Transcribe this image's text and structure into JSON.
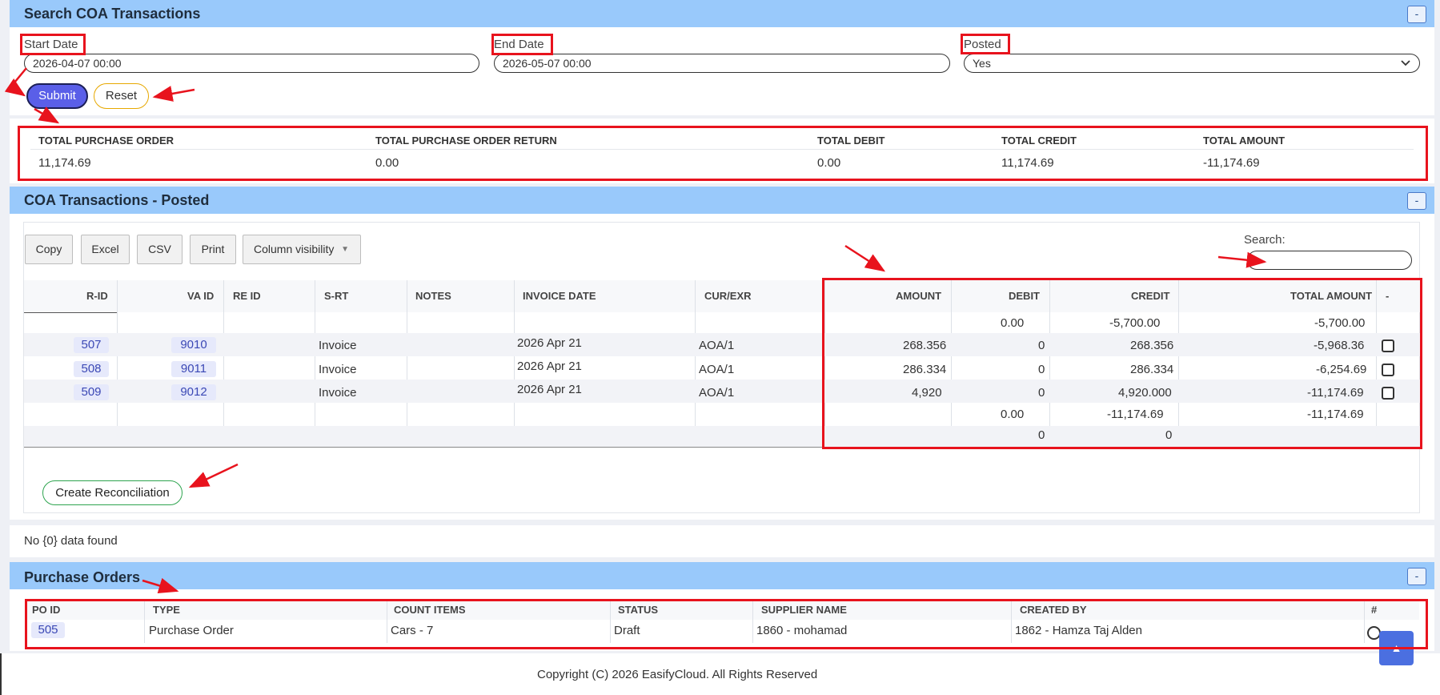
{
  "search_panel": {
    "title": "Search COA Transactions",
    "collapse": "-",
    "start_date_label": "Start Date",
    "start_date_value": "2026-04-07 00:00",
    "end_date_label": "End Date",
    "end_date_value": "2026-05-07 00:00",
    "posted_label": "Posted",
    "posted_value": "Yes",
    "submit_label": "Submit",
    "reset_label": "Reset"
  },
  "summary": {
    "headers": [
      "TOTAL PURCHASE ORDER",
      "TOTAL PURCHASE ORDER RETURN",
      "TOTAL DEBIT",
      "TOTAL CREDIT",
      "TOTAL AMOUNT"
    ],
    "values": [
      "11,174.69",
      "0.00",
      "0.00",
      "11,174.69",
      "-11,174.69"
    ]
  },
  "coa_panel": {
    "title": "COA Transactions - Posted",
    "collapse": "-",
    "buttons": [
      "Copy",
      "Excel",
      "CSV",
      "Print",
      "Column visibility"
    ],
    "column_visibility_caret": "▼",
    "search_label": "Search:",
    "search_value": "",
    "columns": [
      "R-ID",
      "VA ID",
      "RE ID",
      "S-RT",
      "NOTES",
      "INVOICE DATE",
      "CUR/EXR",
      "AMOUNT",
      "DEBIT",
      "CREDIT",
      "TOTAL AMOUNT",
      "-"
    ],
    "opening_row": {
      "debit": "0.00",
      "credit": "-5,700.00",
      "total": "-5,700.00"
    },
    "rows": [
      {
        "rid": "507",
        "vaid": "9010",
        "srt": "Invoice",
        "date": "2026 Apr 21",
        "cur": "AOA/1",
        "amount": "268.356",
        "debit": "0",
        "credit": "268.356",
        "total": "-5,968.36"
      },
      {
        "rid": "508",
        "vaid": "9011",
        "srt": "Invoice",
        "date": "2026 Apr 21",
        "cur": "AOA/1",
        "amount": "286.334",
        "debit": "0",
        "credit": "286.334",
        "total": "-6,254.69"
      },
      {
        "rid": "509",
        "vaid": "9012",
        "srt": "Invoice",
        "date": "2026 Apr 21",
        "cur": "AOA/1",
        "amount": "4,920",
        "debit": "0",
        "credit": "4,920.000",
        "total": "-11,174.69"
      }
    ],
    "closing_row": {
      "debit": "0.00",
      "credit": "-11,174.69",
      "total": "-11,174.69"
    },
    "footer_row": {
      "debit": "0",
      "credit": "0"
    },
    "create_reconciliation_label": "Create Reconciliation"
  },
  "no_data_text": "No {0} data found",
  "po_panel": {
    "title": "Purchase Orders",
    "collapse": "-",
    "columns": [
      "PO ID",
      "TYPE",
      "COUNT ITEMS",
      "STATUS",
      "SUPPLIER NAME",
      "CREATED BY",
      "#"
    ],
    "row": {
      "po_id": "505",
      "type": "Purchase Order",
      "count": "Cars - 7",
      "status": "Draft",
      "supplier": "1860 - mohamad",
      "created_by": "1862 - Hamza Taj Alden"
    }
  },
  "footer": {
    "copyright": "Copyright (C) 2026 EasifyCloud. All Rights Reserved"
  },
  "scroll_top_icon": "▲",
  "colors": {
    "header_blue": "#99c9fb",
    "submit": "#5a5fe8",
    "annotation_red": "#e8131d",
    "badge_bg": "#e6e9fb"
  }
}
